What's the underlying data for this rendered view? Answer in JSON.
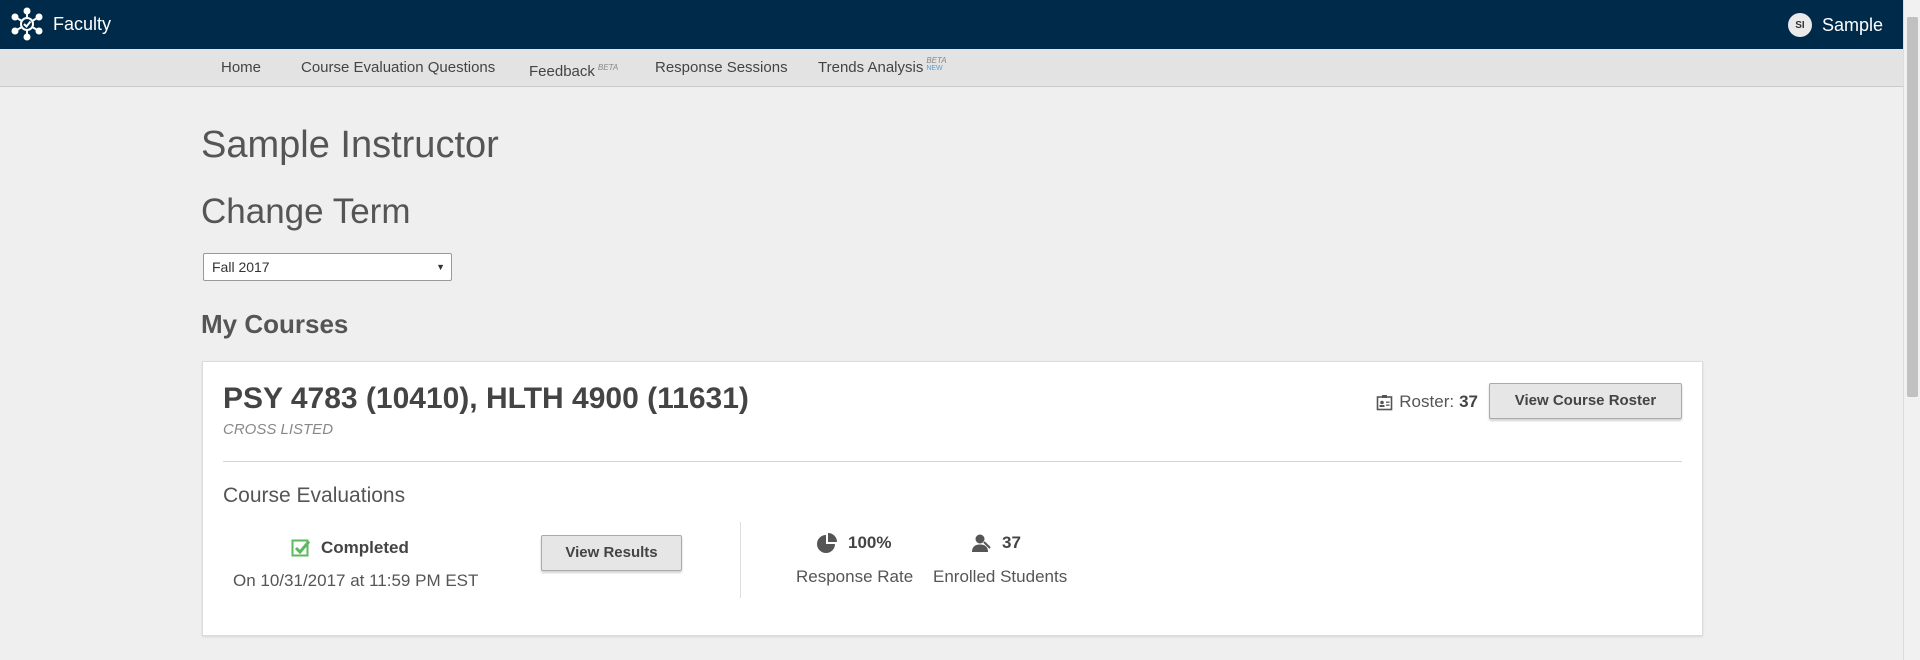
{
  "header": {
    "brand_label": "Faculty",
    "user_initials": "SI",
    "user_name": "Sample"
  },
  "nav": {
    "items": [
      {
        "label": "Home"
      },
      {
        "label": "Course Evaluation Questions"
      },
      {
        "label": "Feedback",
        "badge": "BETA"
      },
      {
        "label": "Response Sessions"
      },
      {
        "label": "Trends Analysis",
        "badge": "BETA",
        "badge2": "NEW"
      }
    ]
  },
  "page": {
    "title": "Sample Instructor",
    "change_term_heading": "Change Term",
    "term_selected": "Fall 2017",
    "courses_heading": "My Courses"
  },
  "course": {
    "title": "PSY 4783 (10410), HLTH 4900 (11631)",
    "subtitle": "CROSS LISTED",
    "roster_label": "Roster:",
    "roster_count": "37",
    "view_roster_label": "View Course Roster",
    "evaluations_heading": "Course Evaluations",
    "status_label": "Completed",
    "status_date": "On 10/31/2017 at 11:59 PM EST",
    "view_results_label": "View Results",
    "response_rate_value": "100%",
    "response_rate_label": "Response Rate",
    "enrolled_value": "37",
    "enrolled_label": "Enrolled Students"
  },
  "colors": {
    "header_bg": "#002a4a",
    "nav_bg": "#e3e3e3",
    "check_green": "#5cb85c",
    "new_badge": "#5b9bd5"
  },
  "icons": {
    "brand": "network-logo-icon",
    "roster": "id-badge-icon",
    "status": "checkbox-checked-icon",
    "rate": "pie-chart-icon",
    "enrolled": "user-icon"
  }
}
